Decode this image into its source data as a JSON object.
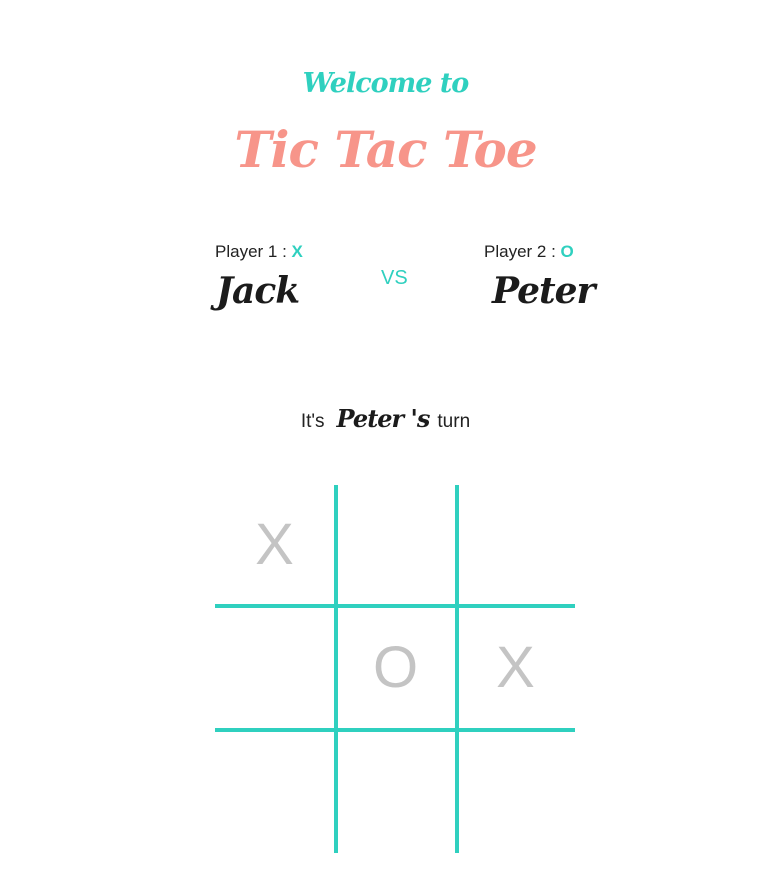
{
  "header": {
    "welcome": "Welcome to",
    "title": "Tic Tac Toe"
  },
  "players": {
    "p1": {
      "label": "Player 1 :",
      "mark": "X",
      "name": "Jack"
    },
    "p2": {
      "label": "Player 2 :",
      "mark": "O",
      "name": "Peter"
    },
    "vs": "VS"
  },
  "turn": {
    "prefix": "It's",
    "name": "Peter",
    "possessive": "'s",
    "suffix": "turn"
  },
  "board": {
    "cells": [
      "X",
      "",
      "",
      "",
      "O",
      "X",
      "",
      "",
      ""
    ]
  },
  "colors": {
    "accent": "#2fd0bf",
    "title": "#f7958a",
    "text": "#222222",
    "mark": "#c4c4c4"
  }
}
